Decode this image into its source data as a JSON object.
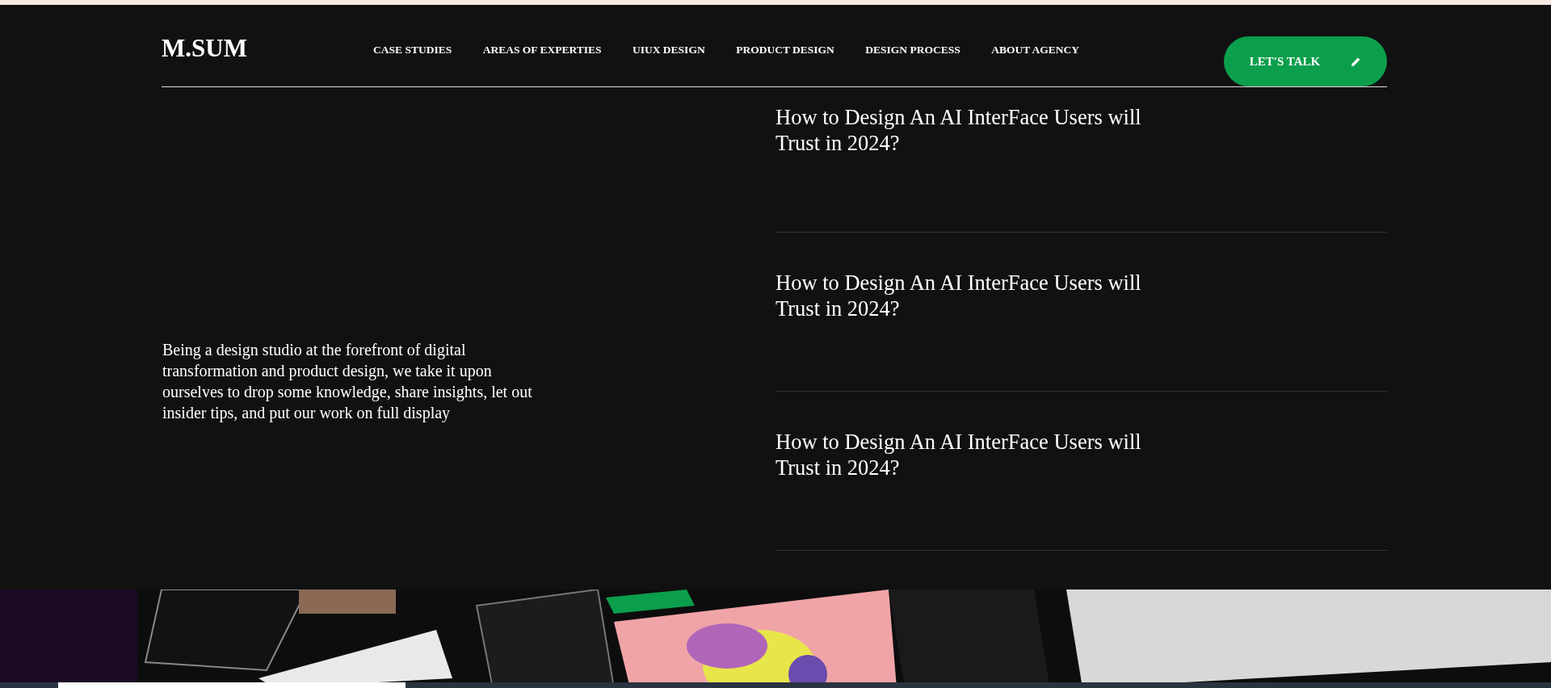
{
  "logo": "M.SUM",
  "nav": [
    "CASE STUDIES",
    "AREAS OF EXPERTIES",
    "UIUX DESIGN",
    "PRODUCT DESIGN",
    "DESIGN PROCESS",
    "ABOUT AGENCY"
  ],
  "cta": {
    "label": "LET'S TALK"
  },
  "intro": "Being a design studio at the forefront of digital transformation and product design, we take it upon ourselves to drop some knowledge, share insights, let out insider tips, and put our work on full display",
  "articles": [
    {
      "title": "How to Design An AI InterFace Users will Trust in 2024?"
    },
    {
      "title": "How to Design An AI InterFace Users will Trust in 2024?"
    },
    {
      "title": "How to Design An AI InterFace Users will Trust in 2024?"
    }
  ]
}
